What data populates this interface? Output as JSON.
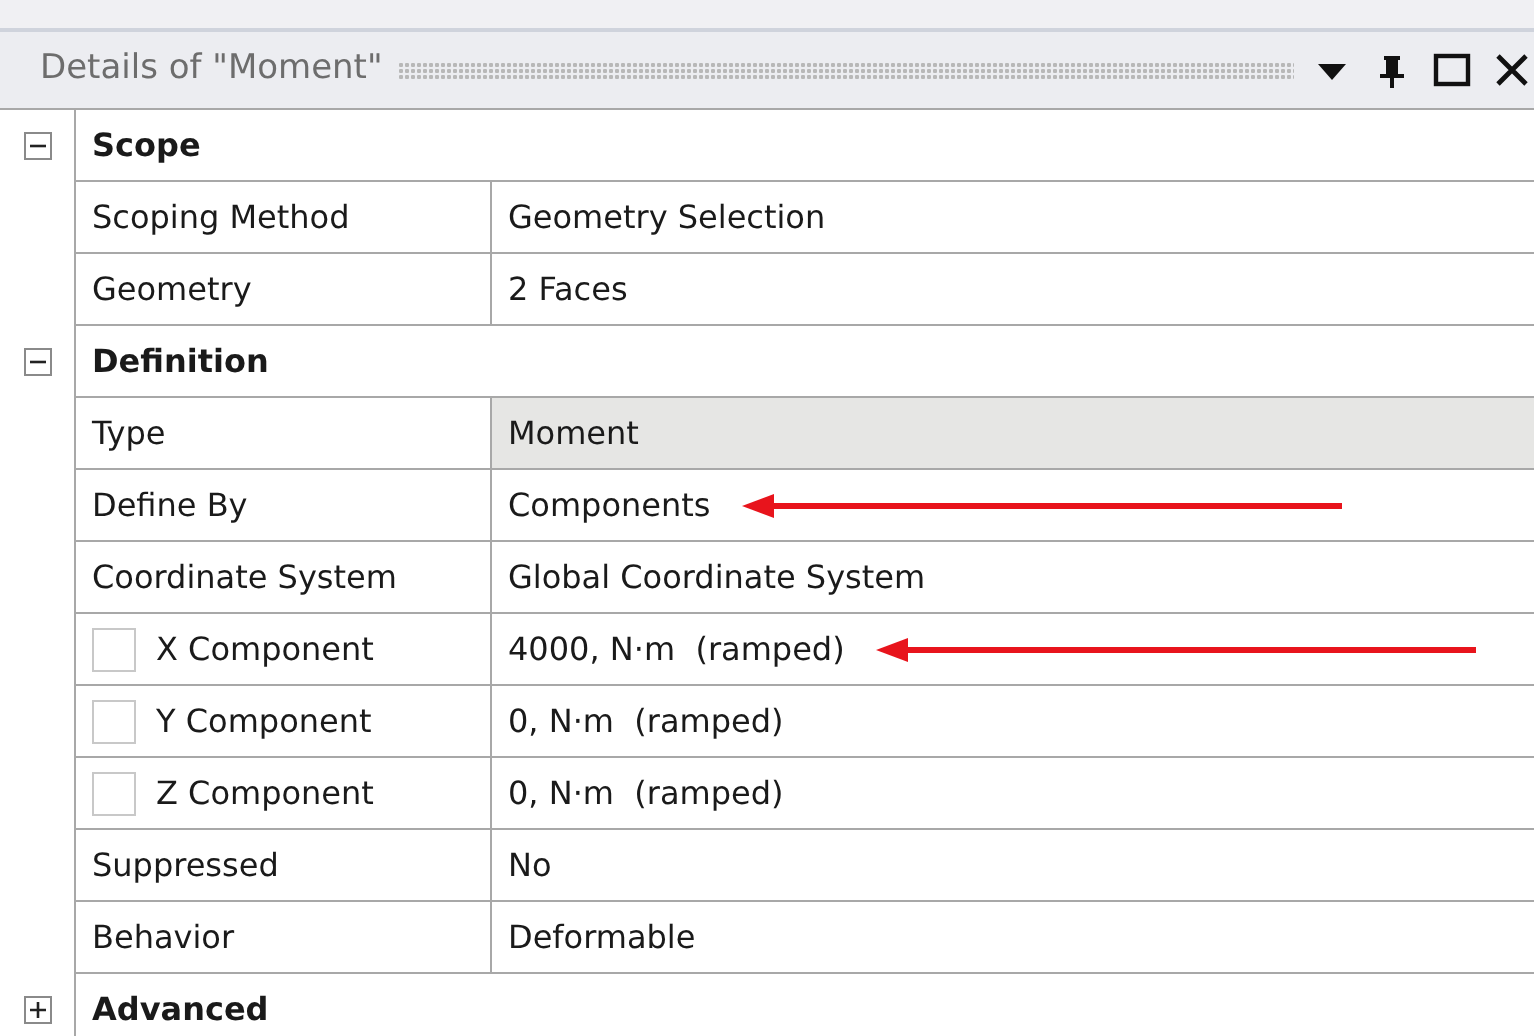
{
  "panel": {
    "title": "Details of \"Moment\""
  },
  "groups": [
    {
      "title": "Scope",
      "expanded": true,
      "rows": [
        {
          "kind": "plain",
          "label": "Scoping Method",
          "value": "Geometry Selection",
          "selected": false,
          "arrow": false
        },
        {
          "kind": "plain",
          "label": "Geometry",
          "value": "2 Faces",
          "selected": false,
          "arrow": false
        }
      ]
    },
    {
      "title": "Definition",
      "expanded": true,
      "rows": [
        {
          "kind": "plain",
          "label": "Type",
          "value": "Moment",
          "selected": true,
          "arrow": false
        },
        {
          "kind": "plain",
          "label": "Define By",
          "value": "Components",
          "selected": false,
          "arrow": true
        },
        {
          "kind": "plain",
          "label": "Coordinate System",
          "value": "Global Coordinate System",
          "selected": false,
          "arrow": false
        },
        {
          "kind": "checkbox",
          "checked": false,
          "label": "X Component",
          "value": "4000, N·m  (ramped)",
          "selected": false,
          "arrow": true
        },
        {
          "kind": "checkbox",
          "checked": false,
          "label": "Y Component",
          "value": "0, N·m  (ramped)",
          "selected": false,
          "arrow": false
        },
        {
          "kind": "checkbox",
          "checked": false,
          "label": "Z Component",
          "value": "0, N·m  (ramped)",
          "selected": false,
          "arrow": false
        },
        {
          "kind": "plain",
          "label": "Suppressed",
          "value": "No",
          "selected": false,
          "arrow": false
        },
        {
          "kind": "plain",
          "label": "Behavior",
          "value": "Deformable",
          "selected": false,
          "arrow": false
        }
      ]
    },
    {
      "title": "Advanced",
      "expanded": false
    }
  ]
}
